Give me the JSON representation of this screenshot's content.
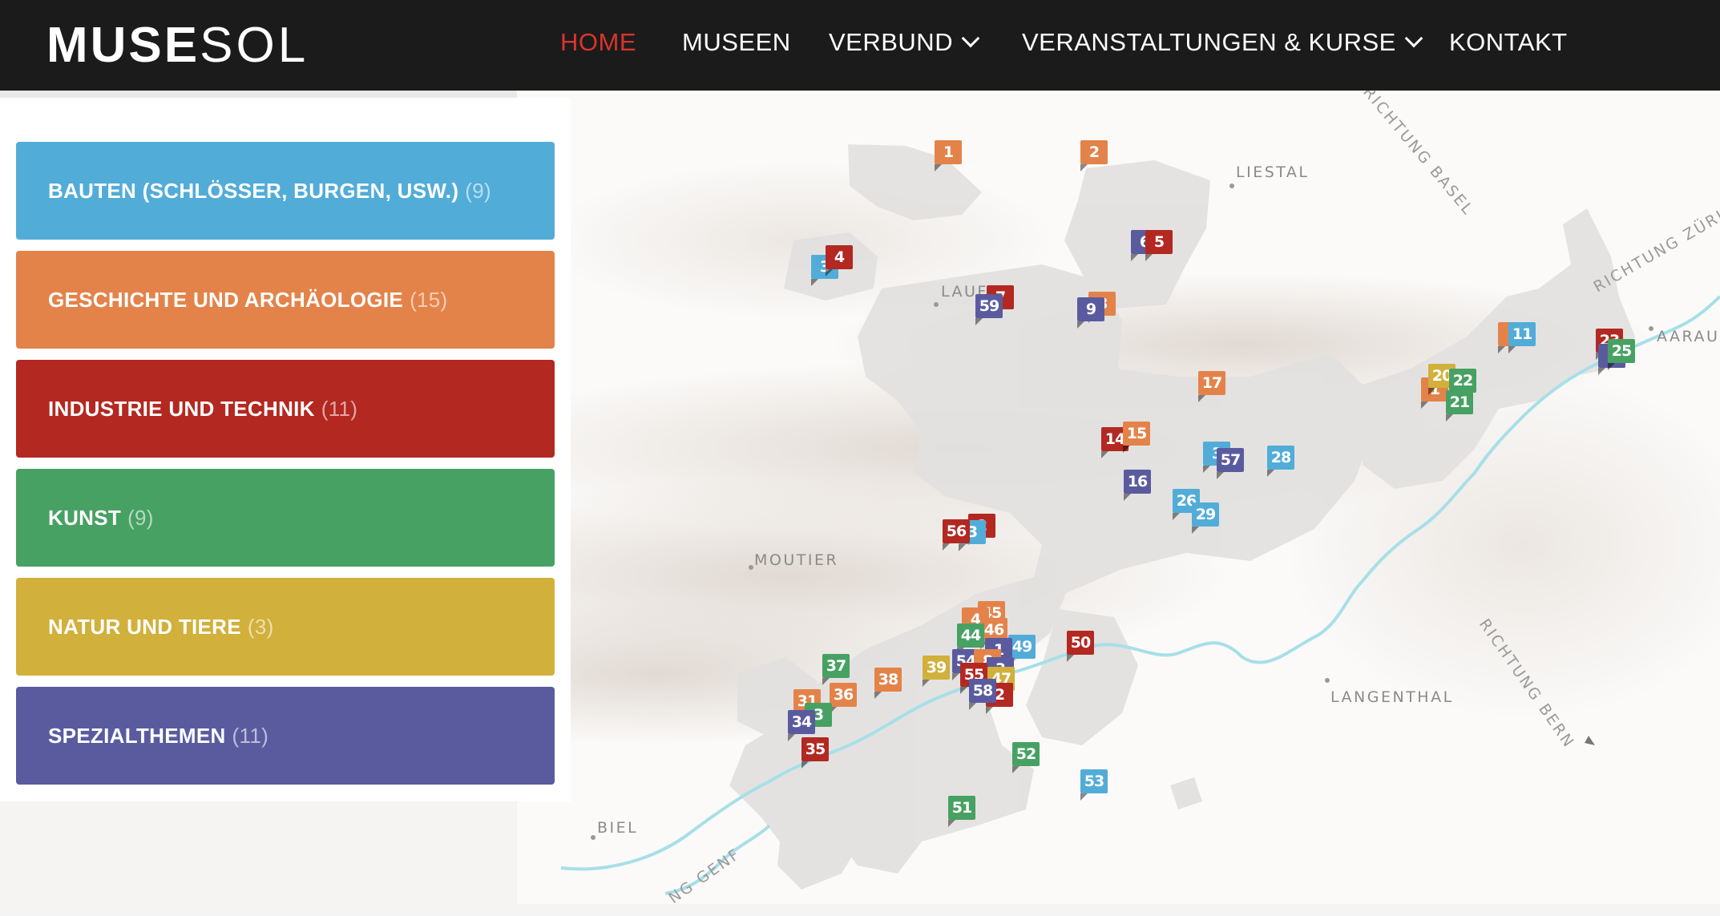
{
  "brand": {
    "logo_bold": "MUSE",
    "logo_light": "SOL"
  },
  "nav": {
    "home": "HOME",
    "museen": "MUSEEN",
    "verbund": "VERBUND",
    "veranstaltungen": "VERANSTALTUNGEN & KURSE",
    "kontakt": "KONTAKT"
  },
  "colors": {
    "nav_active": "#d9342b",
    "bauten": "#52acd8",
    "geschichte": "#e3834a",
    "industrie": "#b32821",
    "kunst": "#47a163",
    "natur": "#d1b03b",
    "spezial": "#5a5b9f",
    "river": "#a7dfe8"
  },
  "categories": [
    {
      "label": "BAUTEN (SCHLÖSSER, BURGEN, USW.)",
      "count": "(9)"
    },
    {
      "label": "GESCHICHTE UND ARCHÄOLOGIE",
      "count": "(15)"
    },
    {
      "label": "INDUSTRIE UND TECHNIK",
      "count": "(11)"
    },
    {
      "label": "KUNST",
      "count": "(9)"
    },
    {
      "label": "NATUR UND TIERE",
      "count": "(3)"
    },
    {
      "label": "SPEZIALTHEMEN",
      "count": "(11)"
    }
  ],
  "places": {
    "liestal": "LIESTAL",
    "laufen": "LAUF",
    "moutier": "MOUTIER",
    "langenthal": "LANGENTHAL",
    "biel": "BIEL",
    "aarau": "AARAU"
  },
  "directions": {
    "basel": "RICHTUNG BASEL",
    "zurich": "RICHTUNG ZÜRIC",
    "bern": "RICHTUNG BERN",
    "genf": "NG GENF"
  },
  "markers": [
    {
      "label": "1",
      "color": "geschichte"
    },
    {
      "label": "2",
      "color": "geschichte"
    },
    {
      "label": "3",
      "color": "bauten"
    },
    {
      "label": "4",
      "color": "industrie"
    },
    {
      "label": "6",
      "color": "spezial"
    },
    {
      "label": "5",
      "color": "industrie"
    },
    {
      "label": "7",
      "color": "industrie"
    },
    {
      "label": "59",
      "color": "spezial"
    },
    {
      "label": "8",
      "color": "geschichte"
    },
    {
      "label": "9",
      "color": "spezial"
    },
    {
      "label": "1",
      "color": "geschichte"
    },
    {
      "label": "11",
      "color": "bauten"
    },
    {
      "label": "23",
      "color": "industrie"
    },
    {
      "label": "2",
      "color": "spezial"
    },
    {
      "label": "25",
      "color": "kunst"
    },
    {
      "label": "1",
      "color": "geschichte"
    },
    {
      "label": "20",
      "color": "natur"
    },
    {
      "label": "22",
      "color": "kunst"
    },
    {
      "label": "21",
      "color": "kunst"
    },
    {
      "label": "17",
      "color": "geschichte"
    },
    {
      "label": "14",
      "color": "industrie"
    },
    {
      "label": "15",
      "color": "geschichte"
    },
    {
      "label": "3",
      "color": "bauten"
    },
    {
      "label": "57",
      "color": "spezial"
    },
    {
      "label": "28",
      "color": "bauten"
    },
    {
      "label": "16",
      "color": "spezial"
    },
    {
      "label": "26",
      "color": "bauten"
    },
    {
      "label": "29",
      "color": "bauten"
    },
    {
      "label": "2",
      "color": "industrie"
    },
    {
      "label": "3",
      "color": "bauten"
    },
    {
      "label": "56",
      "color": "industrie"
    },
    {
      "label": "45",
      "color": "geschichte"
    },
    {
      "label": "4",
      "color": "geschichte"
    },
    {
      "label": "46",
      "color": "geschichte"
    },
    {
      "label": "44",
      "color": "kunst"
    },
    {
      "label": "49",
      "color": "bauten"
    },
    {
      "label": "1",
      "color": "spezial"
    },
    {
      "label": "50",
      "color": "industrie"
    },
    {
      "label": "37",
      "color": "kunst"
    },
    {
      "label": "39",
      "color": "natur"
    },
    {
      "label": "54",
      "color": "spezial"
    },
    {
      "label": "8",
      "color": "geschichte"
    },
    {
      "label": "3",
      "color": "spezial"
    },
    {
      "label": "47",
      "color": "natur"
    },
    {
      "label": "55",
      "color": "industrie"
    },
    {
      "label": "38",
      "color": "geschichte"
    },
    {
      "label": "2",
      "color": "industrie"
    },
    {
      "label": "58",
      "color": "spezial"
    },
    {
      "label": "31",
      "color": "geschichte"
    },
    {
      "label": "36",
      "color": "geschichte"
    },
    {
      "label": "3",
      "color": "kunst"
    },
    {
      "label": "34",
      "color": "spezial"
    },
    {
      "label": "35",
      "color": "industrie"
    },
    {
      "label": "52",
      "color": "kunst"
    },
    {
      "label": "53",
      "color": "bauten"
    },
    {
      "label": "51",
      "color": "kunst"
    }
  ]
}
